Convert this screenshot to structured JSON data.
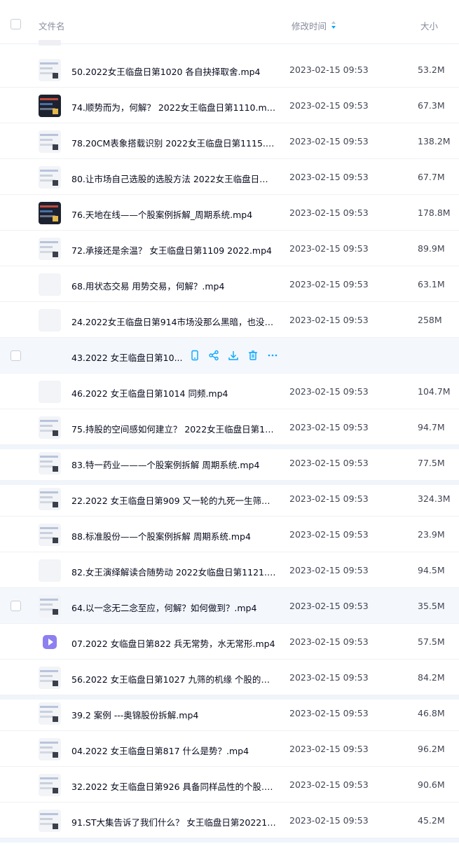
{
  "header": {
    "name_label": "文件名",
    "time_label": "修改时间",
    "size_label": "大小",
    "sort_icon": "sort-arrows-icon"
  },
  "colors": {
    "accent": "#06a7ff",
    "hover_row": "#f4f7fc",
    "video_icon": "#8d7ff0"
  },
  "rows": [
    {
      "name": "50.2022女王临盘日第1020 各自抉择取舍.mp4",
      "time": "2023-02-15 09:53",
      "size": "53.2M"
    },
    {
      "name": "74.顺势而为，何解？ 2022女王临盘日第1110.mp4",
      "time": "2023-02-15 09:53",
      "size": "67.3M"
    },
    {
      "name": "78.20CM表象搭载识别 2022女王临盘日第1115.mp4",
      "time": "2023-02-15 09:53",
      "size": "138.2M"
    },
    {
      "name": "80.让市场自己选股的选股方法 2022女王临盘日第1...",
      "time": "2023-02-15 09:53",
      "size": "67.7M"
    },
    {
      "name": "76.天地在线——个股案例拆解_周期系统.mp4",
      "time": "2023-02-15 09:53",
      "size": "178.8M"
    },
    {
      "name": "72.承接还是余温？ 女王临盘日第1109 2022.mp4",
      "time": "2023-02-15 09:53",
      "size": "89.9M"
    },
    {
      "name": "68.用状态交易 用势交易，何解？.mp4",
      "time": "2023-02-15 09:53",
      "size": "63.1M"
    },
    {
      "name": "24.2022女王临盘日第914市场没那么黑暗，也没那...",
      "time": "2023-02-15 09:53",
      "size": "258M"
    },
    {
      "name": "43.2022 女王临盘日第10...",
      "time": "",
      "size": ""
    },
    {
      "name": "46.2022 女王临盘日第1014 同频.mp4",
      "time": "2023-02-15 09:53",
      "size": "104.7M"
    },
    {
      "name": "75.持股的空间感如何建立？ 2022女王临盘日第1111...",
      "time": "2023-02-15 09:53",
      "size": "94.7M"
    },
    {
      "name": "83.特一药业———个股案例拆解 周期系统.mp4",
      "time": "2023-02-15 09:53",
      "size": "77.5M"
    },
    {
      "name": "22.2022 女王临盘日第909 又一轮的九死一生筛选...",
      "time": "2023-02-15 09:53",
      "size": "324.3M"
    },
    {
      "name": "88.标准股份——个股案例拆解 周期系统.mp4",
      "time": "2023-02-15 09:53",
      "size": "23.9M"
    },
    {
      "name": "82.女王演绎解读合随势动 2022女临盘日第1121.mp4",
      "time": "2023-02-15 09:53",
      "size": "94.5M"
    },
    {
      "name": "64.以一念无二念至应，何解？如何做到？.mp4",
      "time": "2023-02-15 09:53",
      "size": "35.5M"
    },
    {
      "name": "07.2022 女临盘日第822 兵无常势，水无常形.mp4",
      "time": "2023-02-15 09:53",
      "size": "57.5M"
    },
    {
      "name": "56.2022 女王临盘日第1027 九筛的机缘 个股的机...",
      "time": "2023-02-15 09:53",
      "size": "84.2M"
    },
    {
      "name": "39.2 案例 ---奥锦股份拆解.mp4",
      "time": "2023-02-15 09:53",
      "size": "46.8M"
    },
    {
      "name": "04.2022 女王临盘日第817 什么是势？.mp4",
      "time": "2023-02-15 09:53",
      "size": "96.2M"
    },
    {
      "name": "32.2022 女王临盘日第926 具备同样品性的个股.mp4",
      "time": "2023-02-15 09:53",
      "size": "90.6M"
    },
    {
      "name": "91.ST大集告诉了我们什么？ 女王临盘日第2022112...",
      "time": "2023-02-15 09:53",
      "size": "45.2M"
    }
  ],
  "hover_actions": [
    "phone-icon",
    "share-icon",
    "download-icon",
    "delete-icon",
    "more-icon"
  ]
}
